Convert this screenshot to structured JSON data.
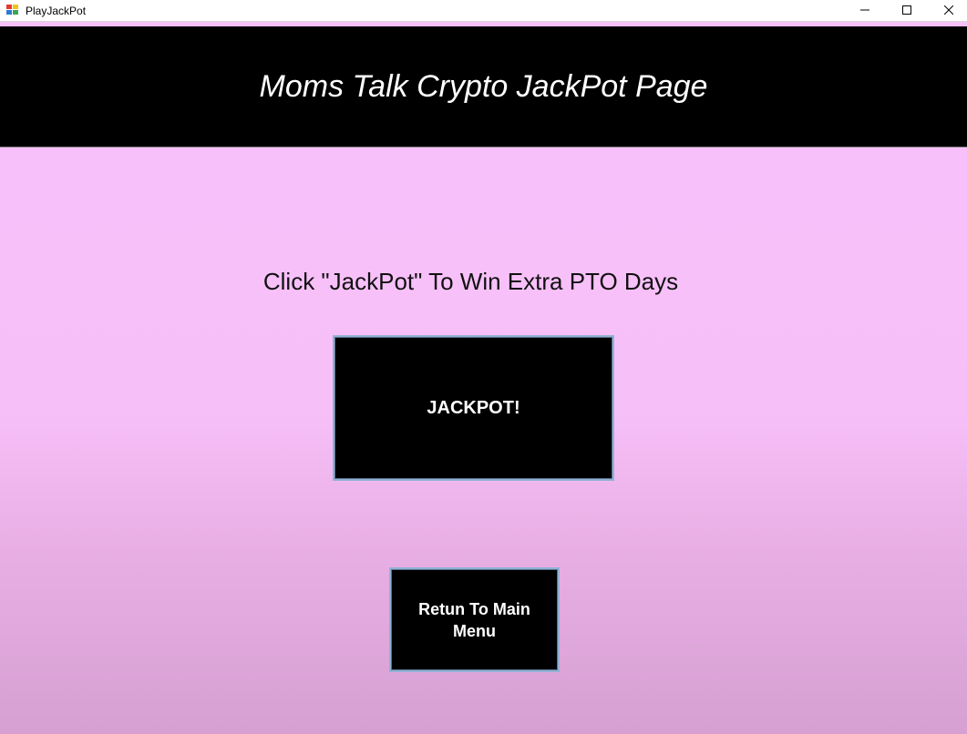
{
  "window": {
    "title": "PlayJackPot",
    "icon": "app-window-icon"
  },
  "controls": {
    "minimize": "minimize-icon",
    "maximize": "maximize-icon",
    "close": "close-icon"
  },
  "banner": {
    "title": "Moms Talk Crypto JackPot Page"
  },
  "main": {
    "prompt": "Click \"JackPot\" To Win Extra PTO Days",
    "jackpot_label": "JACKPOT!",
    "return_label": "Retun To Main Menu"
  },
  "colors": {
    "background": "#f9c1fb",
    "banner": "#000000",
    "button": "#000000",
    "button_border": "#8fb2d6",
    "text_light": "#ffffff"
  }
}
